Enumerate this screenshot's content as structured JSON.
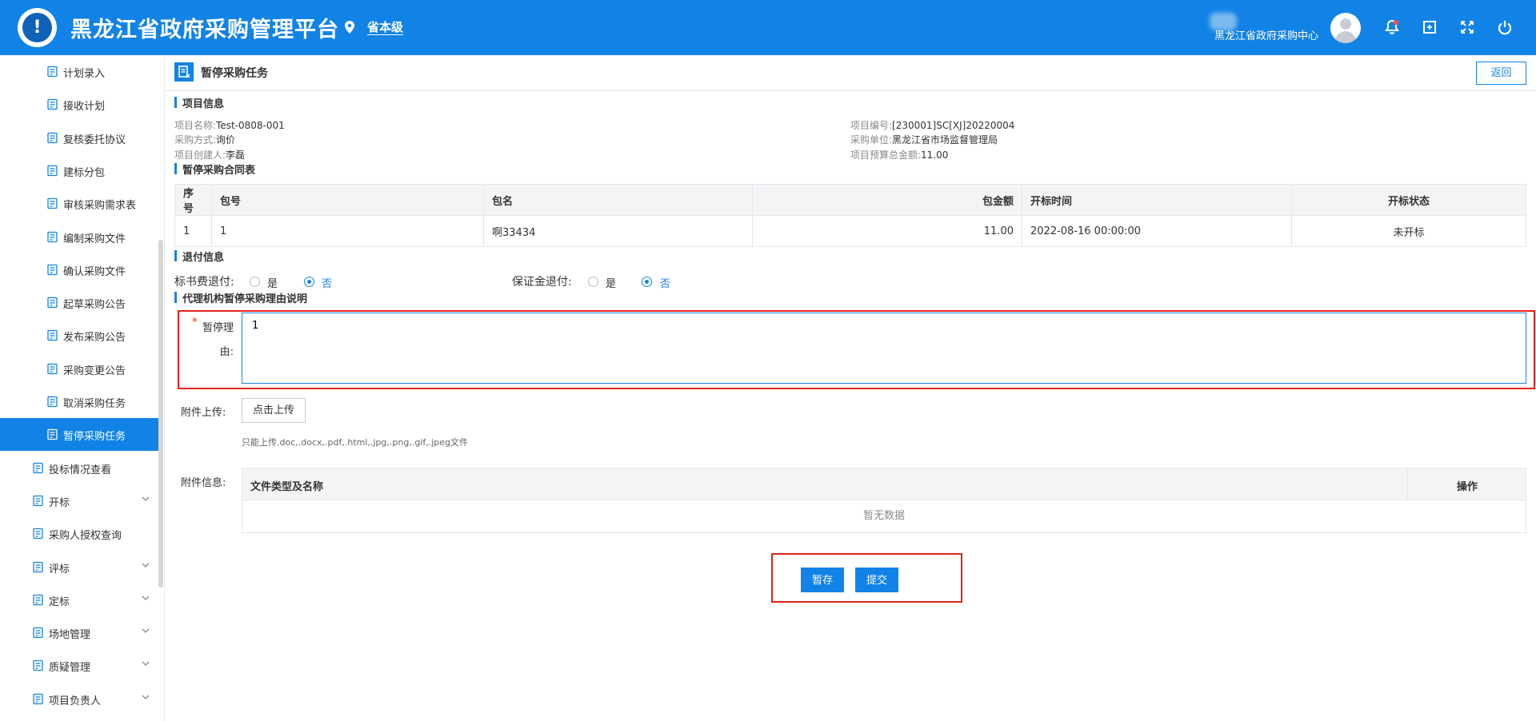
{
  "header": {
    "title": "黑龙江省政府采购管理平台",
    "location": "省本级",
    "user_org": "黑龙江省政府采购中心",
    "accent": "#1283e6"
  },
  "sidebar": {
    "items": [
      {
        "label": "计划录入",
        "icon": "form-icon"
      },
      {
        "label": "接收计划",
        "icon": "receive-icon"
      },
      {
        "label": "复核委托协议",
        "icon": "document-icon"
      },
      {
        "label": "建标分包",
        "icon": "edit-doc-icon"
      },
      {
        "label": "审核采购需求表",
        "icon": "clipboard-icon"
      },
      {
        "label": "编制采购文件",
        "icon": "document-icon"
      },
      {
        "label": "确认采购文件",
        "icon": "check-doc-icon"
      },
      {
        "label": "起草采购公告",
        "icon": "cart-icon"
      },
      {
        "label": "发布采购公告",
        "icon": "users-icon"
      },
      {
        "label": "采购变更公告",
        "icon": "list-icon"
      },
      {
        "label": "取消采购任务",
        "icon": "cancel-doc-icon"
      },
      {
        "label": "暂停采购任务",
        "icon": "pause-doc-icon"
      }
    ],
    "groups": [
      {
        "label": "投标情况查看",
        "icon": "search-doc-icon",
        "expandable": false
      },
      {
        "label": "开标",
        "icon": "gavel-icon",
        "expandable": true
      },
      {
        "label": "采购人授权查询",
        "icon": "shield-icon",
        "expandable": false
      },
      {
        "label": "评标",
        "icon": "badge-icon",
        "expandable": true
      },
      {
        "label": "定标",
        "icon": "target-doc-icon",
        "expandable": true
      },
      {
        "label": "场地管理",
        "icon": "user-icon",
        "expandable": true
      },
      {
        "label": "质疑管理",
        "icon": "cart-icon",
        "expandable": true
      },
      {
        "label": "项目负责人",
        "icon": "user-circle-icon",
        "expandable": true
      }
    ]
  },
  "page": {
    "title": "暂停采购任务",
    "back_label": "返回"
  },
  "project_info": {
    "section_title": "项目信息",
    "name_label": "项目名称:",
    "name": "Test-0808-001",
    "method_label": "采购方式:",
    "method": "询价",
    "creator_label": "项目创建人:",
    "creator": "李磊",
    "code_label": "项目编号:",
    "code": "[230001]SC[XJ]20220004",
    "unit_label": "采购单位:",
    "unit": "黑龙江省市场监督管理局",
    "budget_label": "项目预算总金额:",
    "budget": "11.00"
  },
  "contract_table": {
    "section_title": "暂停采购合同表",
    "columns": [
      "序号",
      "包号",
      "包名",
      "包金额",
      "开标时间",
      "开标状态"
    ],
    "rows": [
      [
        "1",
        "1",
        "啊33434",
        "11.00",
        "2022-08-16 00:00:00",
        "未开标"
      ]
    ]
  },
  "refund": {
    "section_title": "退付信息",
    "bid_fee_label": "标书费退付:",
    "deposit_label": "保证金退付:",
    "yes": "是",
    "no": "否",
    "bid_fee_selected": "否",
    "deposit_selected": "否"
  },
  "reason": {
    "section_title": "代理机构暂停采购理由说明",
    "required_mark": "*",
    "label_line1": "暂停理",
    "label_line2": "由:",
    "value": "1"
  },
  "attachment": {
    "upload_label": "附件上传:",
    "upload_button": "点击上传",
    "hint": "只能上传.doc,.docx,.pdf,.html,.jpg,.png,.gif,.jpeg文件",
    "info_label": "附件信息:",
    "col_name": "文件类型及名称",
    "col_action": "操作",
    "empty_text": "暂无数据"
  },
  "actions": {
    "save_label": "暂存",
    "submit_label": "提交"
  }
}
